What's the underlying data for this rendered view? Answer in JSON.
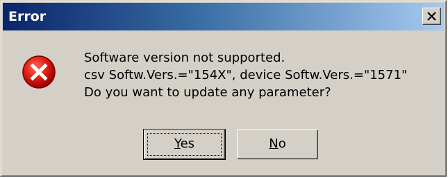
{
  "window": {
    "title": "Error",
    "close_icon": "close-icon"
  },
  "icon": {
    "name": "error-icon",
    "color": "#cc0000"
  },
  "message": {
    "lines": [
      "Software version not supported.",
      "csv Softw.Vers.=\"154X\", device Softw.Vers.=\"1571\"",
      "Do you want to update any parameter?"
    ]
  },
  "buttons": {
    "yes": {
      "accel": "Y",
      "rest": "es"
    },
    "no": {
      "accel": "N",
      "rest": "o"
    }
  },
  "colors": {
    "title_gradient_start": "#0a246a",
    "title_gradient_end": "#a6caf0",
    "dialog_face": "#d4d0c8"
  }
}
